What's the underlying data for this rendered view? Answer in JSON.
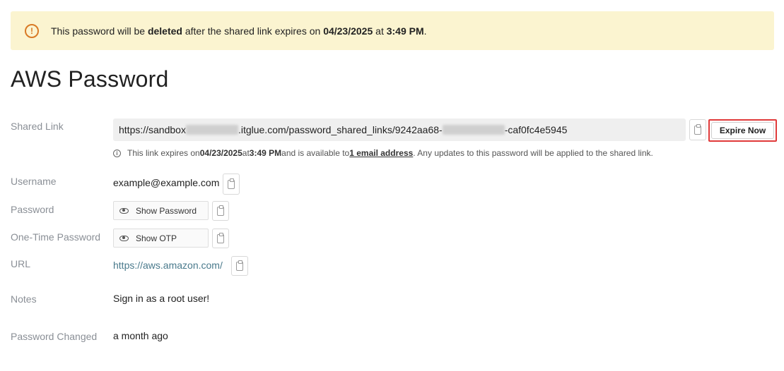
{
  "banner": {
    "icon": "warning-circle-icon",
    "text_pre": "This password will be ",
    "text_bold1": "deleted",
    "text_mid": " after the shared link expires on ",
    "text_date": "04/23/2025",
    "text_at": " at ",
    "text_time": "3:49 PM",
    "text_end": "."
  },
  "title": "AWS Password",
  "shared_link": {
    "label": "Shared Link",
    "url_part1": "https://sandbox",
    "url_part2": ".itglue.com/password_shared_links/9242aa68-",
    "url_part3": "-caf0fc4e5945",
    "expire_button": "Expire Now"
  },
  "info": {
    "pre": "This link expires on ",
    "date": "04/23/2025",
    "at": " at ",
    "time": "3:49 PM",
    "mid": " and is available to ",
    "recipients": "1 email address",
    "end": ". Any updates to this password will be applied to the shared link."
  },
  "fields": {
    "username_label": "Username",
    "username_value": "example@example.com",
    "password_label": "Password",
    "password_button": "Show Password",
    "otp_label": "One-Time Password",
    "otp_button": "Show OTP",
    "url_label": "URL",
    "url_value": "https://aws.amazon.com/",
    "notes_label": "Notes",
    "notes_value": "Sign in as a root user!",
    "changed_label": "Password Changed",
    "changed_value": "a month ago"
  },
  "colors": {
    "banner_bg": "#fbf4d0",
    "warning": "#d97a26",
    "highlight_outline": "#e03a3a",
    "link": "#4a7a8c"
  }
}
